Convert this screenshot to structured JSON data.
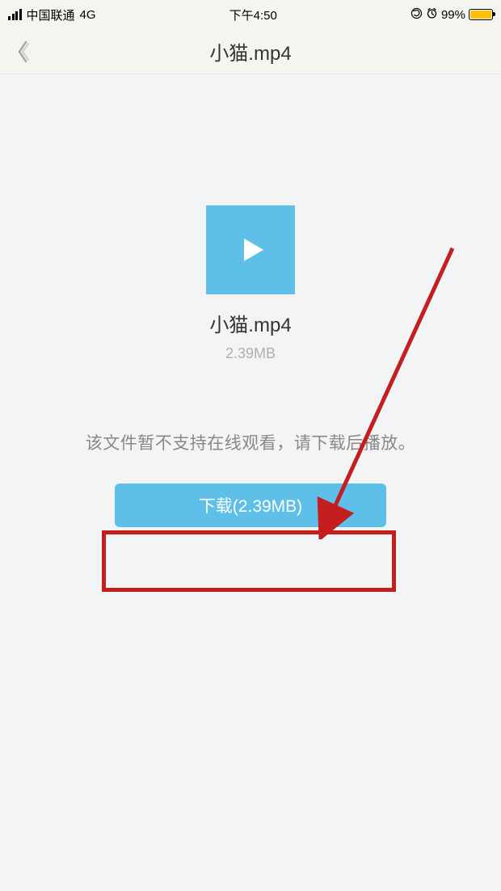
{
  "status_bar": {
    "carrier": "中国联通",
    "network": "4G",
    "time": "下午4:50",
    "battery_percent": "99%"
  },
  "nav": {
    "title": "小猫.mp4"
  },
  "file": {
    "name": "小猫.mp4",
    "size": "2.39MB"
  },
  "hint": "该文件暂不支持在线观看，请下载后播放。",
  "download_button": "下载(2.39MB)"
}
